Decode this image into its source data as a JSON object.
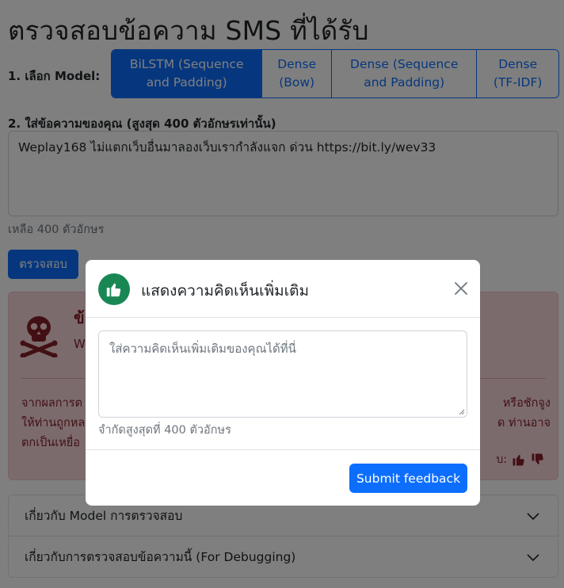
{
  "page": {
    "title": "ตรวจสอบข้อความ SMS ที่ได้รับ",
    "step1_label": "1. เลือก Model:",
    "models": [
      {
        "line1": "BiLSTM (Sequence",
        "line2": "and Padding)"
      },
      {
        "line1": "Dense",
        "line2": "(Bow)"
      },
      {
        "line1": "Dense (Sequence",
        "line2": "and Padding)"
      },
      {
        "line1": "Dense",
        "line2": "(TF-IDF)"
      }
    ],
    "selected_model": "BiLSTM (Sequence and Padding)",
    "step2_label": "2. ใส่ข้อความของคุณ (สูงสุด 400 ตัวอักษรเท่านั้น)",
    "message_value": "Weplay168 ไม่แตกเว็บอื่นมาลองเว็บเรากำลังแจก ด่วน https://bit.ly/wev33",
    "remaining": "เหลือ 400 ตัวอักษร",
    "check_button": "ตรวจสอบ"
  },
  "result": {
    "heading": "ข้",
    "sub": "We",
    "body_left_line1": "จากผลการต",
    "body_left_line2": "ให้ท่านถูกหล",
    "body_left_line3": "ตกเป็นเหยื่อ",
    "body_right_line1": "หรือชักจูง",
    "body_right_line2": "ด ท่านอาจ",
    "vote_text": "บ:",
    "alert_color": "#f8d7da"
  },
  "accordion": {
    "item1": "เกี่ยวกับ Model การตรวจสอบ",
    "item2": "เกี่ยวกับการตรวจสอบข้อความนี้ (For Debugging)"
  },
  "modal": {
    "title": "แสดงความคิดเห็นเพิ่มเติม",
    "placeholder": "ใส่ความคิดเห็นเพิ่มเติมของคุณได้ที่นี่",
    "limit_text": "จำกัดสูงสุดที่ 400 ตัวอักษร",
    "submit": "Submit feedback",
    "icon": "thumbs-up-icon",
    "icon_bg": "#198754"
  },
  "colors": {
    "primary": "#0d6efd",
    "danger_text": "#842029"
  }
}
